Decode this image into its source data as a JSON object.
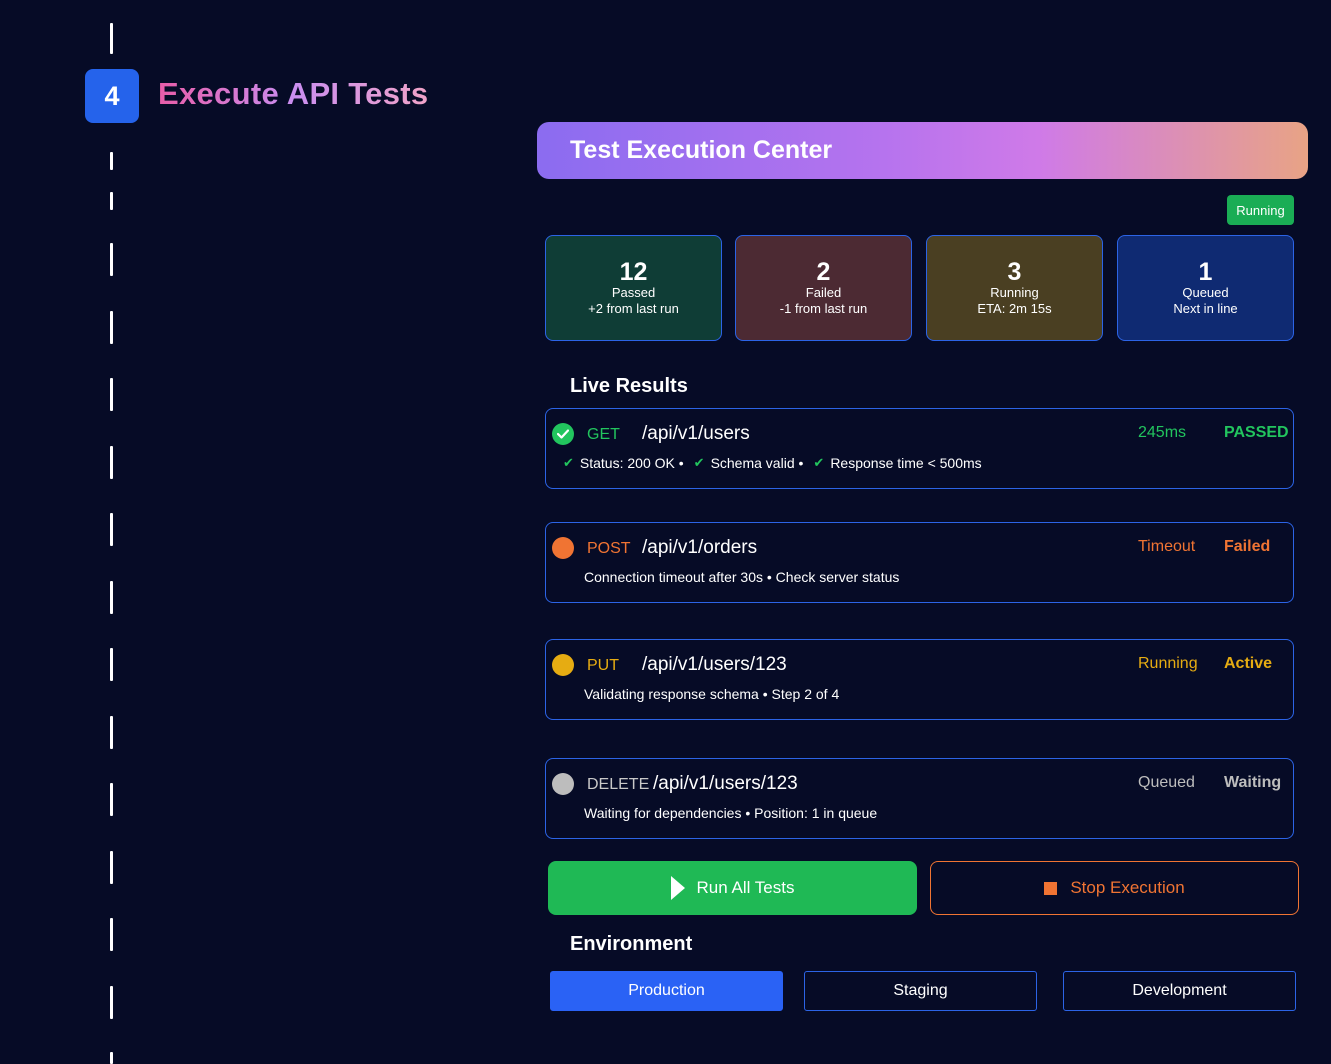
{
  "step": {
    "number": "4",
    "title": "Execute API Tests"
  },
  "panel": {
    "title": "Test Execution Center",
    "state_badge": "Running"
  },
  "stats": [
    {
      "value": "12",
      "label": "Passed",
      "sub": "+2 from last run",
      "color": "#0f3d36"
    },
    {
      "value": "2",
      "label": "Failed",
      "sub": "-1 from last run",
      "color": "#4c2a33"
    },
    {
      "value": "3",
      "label": "Running",
      "sub": "ETA: 2m 15s",
      "color": "#4a3f22"
    },
    {
      "value": "1",
      "label": "Queued",
      "sub": "Next in line",
      "color": "#0f2a72"
    }
  ],
  "live_results": {
    "title": "Live Results",
    "items": [
      {
        "icon": "check-circle-icon",
        "method": "GET",
        "path": "/api/v1/users",
        "meta": "245ms",
        "status": "PASSED",
        "color": "#22c55e",
        "checks": [
          "Status: 200 OK •",
          "Schema valid •",
          "Response time < 500ms"
        ]
      },
      {
        "icon": "status-dot-icon",
        "method": "POST",
        "path": "/api/v1/orders",
        "meta": "Timeout",
        "status": "Failed",
        "color": "#f07433",
        "detail": "Connection timeout after 30s • Check server status"
      },
      {
        "icon": "status-dot-icon",
        "method": "PUT",
        "path": "/api/v1/users/123",
        "meta": "Running",
        "status": "Active",
        "color": "#e6ac12",
        "detail": "Validating response schema • Step 2 of 4"
      },
      {
        "icon": "status-dot-icon",
        "method": "DELETE",
        "path": "/api/v1/users/123",
        "meta": "Queued",
        "status": "Waiting",
        "color": "#bdbdbd",
        "detail": "Waiting for dependencies • Position: 1 in queue"
      }
    ]
  },
  "actions": {
    "run_all": "Run All Tests",
    "stop": "Stop Execution"
  },
  "environment": {
    "title": "Environment",
    "options": [
      "Production",
      "Staging",
      "Development"
    ],
    "selected": "Production"
  }
}
